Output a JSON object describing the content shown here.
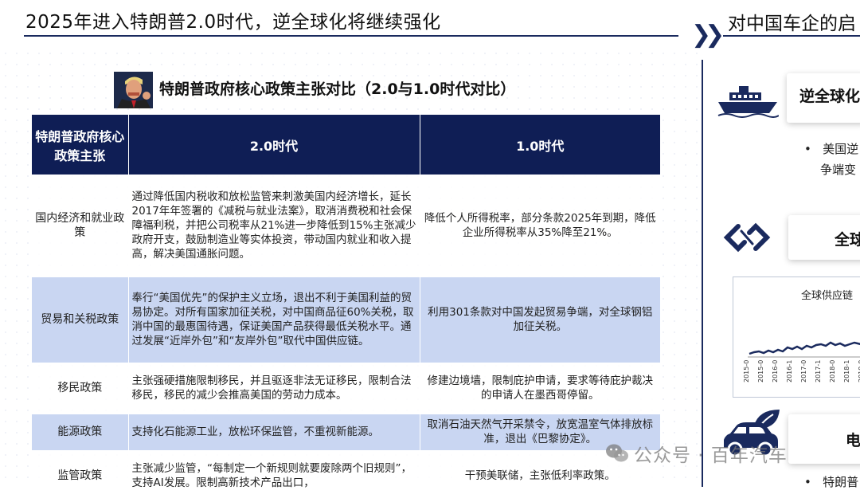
{
  "header": {
    "title": "2025年进入特朗普2.0时代，逆全球化将继续强化",
    "right_title": "对中国车企的启"
  },
  "table": {
    "subtitle": "特朗普政府核心政策主张对比（2.0与1.0时代对比）",
    "headers": [
      "特朗普政府核心政策主张",
      "2.0时代",
      "1.0时代"
    ],
    "rows": [
      {
        "category": "国内经济和就业政策",
        "v2": "通过降低国内税收和放松监管来刺激美国内经济增长，延长2017年年签署的《减税与就业法案》，取消消费税和社会保障福利税，并把公司税率从21%进一步降低到15%主张减少政府开支，鼓励制造业等实体投资，带动国内就业和收入提高，解决美国通胀问题。",
        "v1": "降低个人所得税率，部分条款2025年到期，降低企业所得税率从35%降至21%。"
      },
      {
        "category": "贸易和关税政策",
        "v2": "奉行“美国优先”的保护主义立场，退出不利于美国利益的贸易协定。对所有国家加征关税，对中国商品征60%关税，取消中国的最惠国待遇，保证美国产品获得最低关税水平。通过发展“近岸外包”和“友岸外包”取代中国供应链。",
        "v1": "利用301条款对中国发起贸易争端，对全球钢铝加征关税。"
      },
      {
        "category": "移民政策",
        "v2": "主张强硬措施限制移民，并且驱逐非法无证移民，限制合法移民，移民的减少会推高美国的劳动力成本。",
        "v1": "修建边境墙，限制庇护申请，要求等待庇护裁决的申请人在墨西哥停留。"
      },
      {
        "category": "能源政策",
        "v2": "支持化石能源工业，放松环保监管，不重视新能源。",
        "v1": "取消石油天然气开采禁令，放宽温室气体排放标准，退出《巴黎协定》。"
      },
      {
        "category": "监管政策",
        "v2": "主张减少监管，“每制定一个新规则就要废除两个旧规则”，支持AI发展。限制高新技术产品出口，",
        "v1": "干预美联储，主张低利率政策。"
      }
    ]
  },
  "right_panel": {
    "card1_title": "逆全球化",
    "bullet1_line1": "美国逆",
    "bullet1_line2": "争端变",
    "card2_title": "全球",
    "chart_title": "全球供应链",
    "chart_ticks": [
      "2015-0",
      "2015-0",
      "2016-0",
      "2016-1",
      "2017-0",
      "2017-1",
      "2018-0",
      "2018-1",
      "2019-0"
    ],
    "card3_title": "电",
    "bullet3_line1": "特朗普"
  },
  "watermark": "公众号 · 百年汽车",
  "colors": {
    "header_navy": "#0f1e55",
    "row_blue": "#c9d6f2",
    "accent": "#1a2a5e"
  }
}
